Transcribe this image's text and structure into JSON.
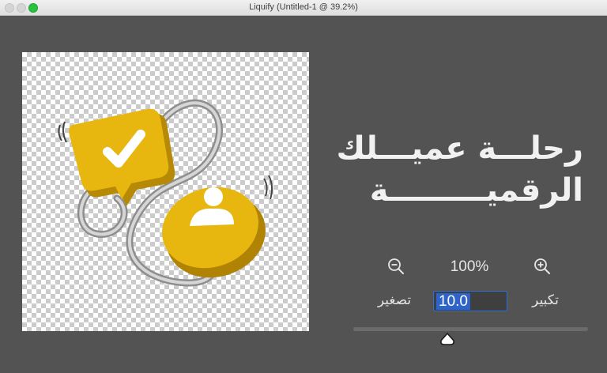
{
  "window": {
    "title": "Liquify (Untitled-1 @ 39.2%)"
  },
  "canvas": {
    "headline_line1": "رحلـــة عميـــلك",
    "headline_line2": "الرقميـــــــــة"
  },
  "zoom": {
    "readout": "100%",
    "zoom_out_icon": "zoom-out-magnifier",
    "zoom_in_icon": "zoom-in-magnifier"
  },
  "brush_size": {
    "shrink_label": "تصغير",
    "enlarge_label": "تكبير",
    "value": "10.0",
    "slider_fraction": 0.4
  },
  "colors": {
    "accent": "#2f6fd6",
    "panel": "#535353",
    "brand_yellow": "#e8b70f"
  }
}
